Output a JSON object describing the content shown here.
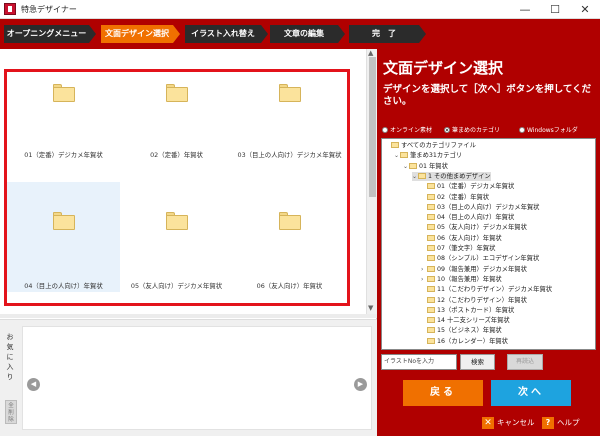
{
  "window": {
    "title": "特急デザイナー",
    "minimize": "—",
    "maximize": "☐",
    "close": "✕"
  },
  "steps": [
    {
      "label": "オープニングメニュー",
      "active": false
    },
    {
      "label": "文面デザイン選択",
      "active": true
    },
    {
      "label": "イラスト入れ替え",
      "active": false
    },
    {
      "label": "文章の編集",
      "active": false
    },
    {
      "label": "完　了",
      "active": false
    }
  ],
  "grid": {
    "items": [
      {
        "label": "01（定番）デジカメ年賀状",
        "selected": false
      },
      {
        "label": "02（定番）年賀状",
        "selected": false
      },
      {
        "label": "03（目上の人向け）デジカメ年賀状",
        "selected": false
      },
      {
        "label": "04（目上の人向け）年賀状",
        "selected": true
      },
      {
        "label": "05（友人向け）デジカメ年賀状",
        "selected": false
      },
      {
        "label": "06（友人向け）年賀状",
        "selected": false
      }
    ]
  },
  "favorites": {
    "label": "お気に入り",
    "clear": "全削除",
    "prev": "◀",
    "next": "▶"
  },
  "panel": {
    "title": "文面デザイン選択",
    "instruction": "デザインを選択して［次へ］ボタンを押してください。",
    "radios": [
      {
        "label": "オンライン素材",
        "checked": false
      },
      {
        "label": "筆まめのカテゴリ",
        "checked": true
      },
      {
        "label": "Windowsフォルダ",
        "checked": false
      }
    ],
    "tree": [
      {
        "label": "すべてのカテゴリファイル",
        "indent": 0,
        "toggle": "",
        "hl": false
      },
      {
        "label": "筆まめ31カテゴリ",
        "indent": 1,
        "toggle": "⌄",
        "hl": false
      },
      {
        "label": "01 年賀状",
        "indent": 2,
        "toggle": "⌄",
        "hl": false
      },
      {
        "label": "1 その他まめデザイン",
        "indent": 3,
        "toggle": "⌄",
        "hl": true
      },
      {
        "label": "01（定番）デジカメ年賀状",
        "indent": 4,
        "toggle": "",
        "hl": false
      },
      {
        "label": "02（定番）年賀状",
        "indent": 4,
        "toggle": "",
        "hl": false
      },
      {
        "label": "03（目上の人向け）デジカメ年賀状",
        "indent": 4,
        "toggle": "",
        "hl": false
      },
      {
        "label": "04（目上の人向け）年賀状",
        "indent": 4,
        "toggle": "",
        "hl": false
      },
      {
        "label": "05（友人向け）デジカメ年賀状",
        "indent": 4,
        "toggle": "",
        "hl": false
      },
      {
        "label": "06（友人向け）年賀状",
        "indent": 4,
        "toggle": "",
        "hl": false
      },
      {
        "label": "07（筆文字）年賀状",
        "indent": 4,
        "toggle": "",
        "hl": false
      },
      {
        "label": "08（シンプル）エコデザイン年賀状",
        "indent": 4,
        "toggle": "",
        "hl": false
      },
      {
        "label": "09（報告兼用）デジカメ年賀状",
        "indent": 4,
        "toggle": "›",
        "hl": false
      },
      {
        "label": "10（報告兼用）年賀状",
        "indent": 4,
        "toggle": "›",
        "hl": false
      },
      {
        "label": "11（こだわりデザイン）デジカメ年賀状",
        "indent": 4,
        "toggle": "",
        "hl": false
      },
      {
        "label": "12（こだわりデザイン）年賀状",
        "indent": 4,
        "toggle": "",
        "hl": false
      },
      {
        "label": "13（ポストカード）年賀状",
        "indent": 4,
        "toggle": "",
        "hl": false
      },
      {
        "label": "14 十二支シリーズ年賀状",
        "indent": 4,
        "toggle": "",
        "hl": false
      },
      {
        "label": "15（ビジネス）年賀状",
        "indent": 4,
        "toggle": "",
        "hl": false
      },
      {
        "label": "16（カレンダー）年賀状",
        "indent": 4,
        "toggle": "",
        "hl": false
      }
    ],
    "search_placeholder": "イラストNoを入力",
    "search_button": "検索",
    "reload_button": "再読込",
    "back_button": "戻る",
    "next_button": "次へ",
    "cancel": "キャンセル",
    "help": "ヘルプ"
  }
}
